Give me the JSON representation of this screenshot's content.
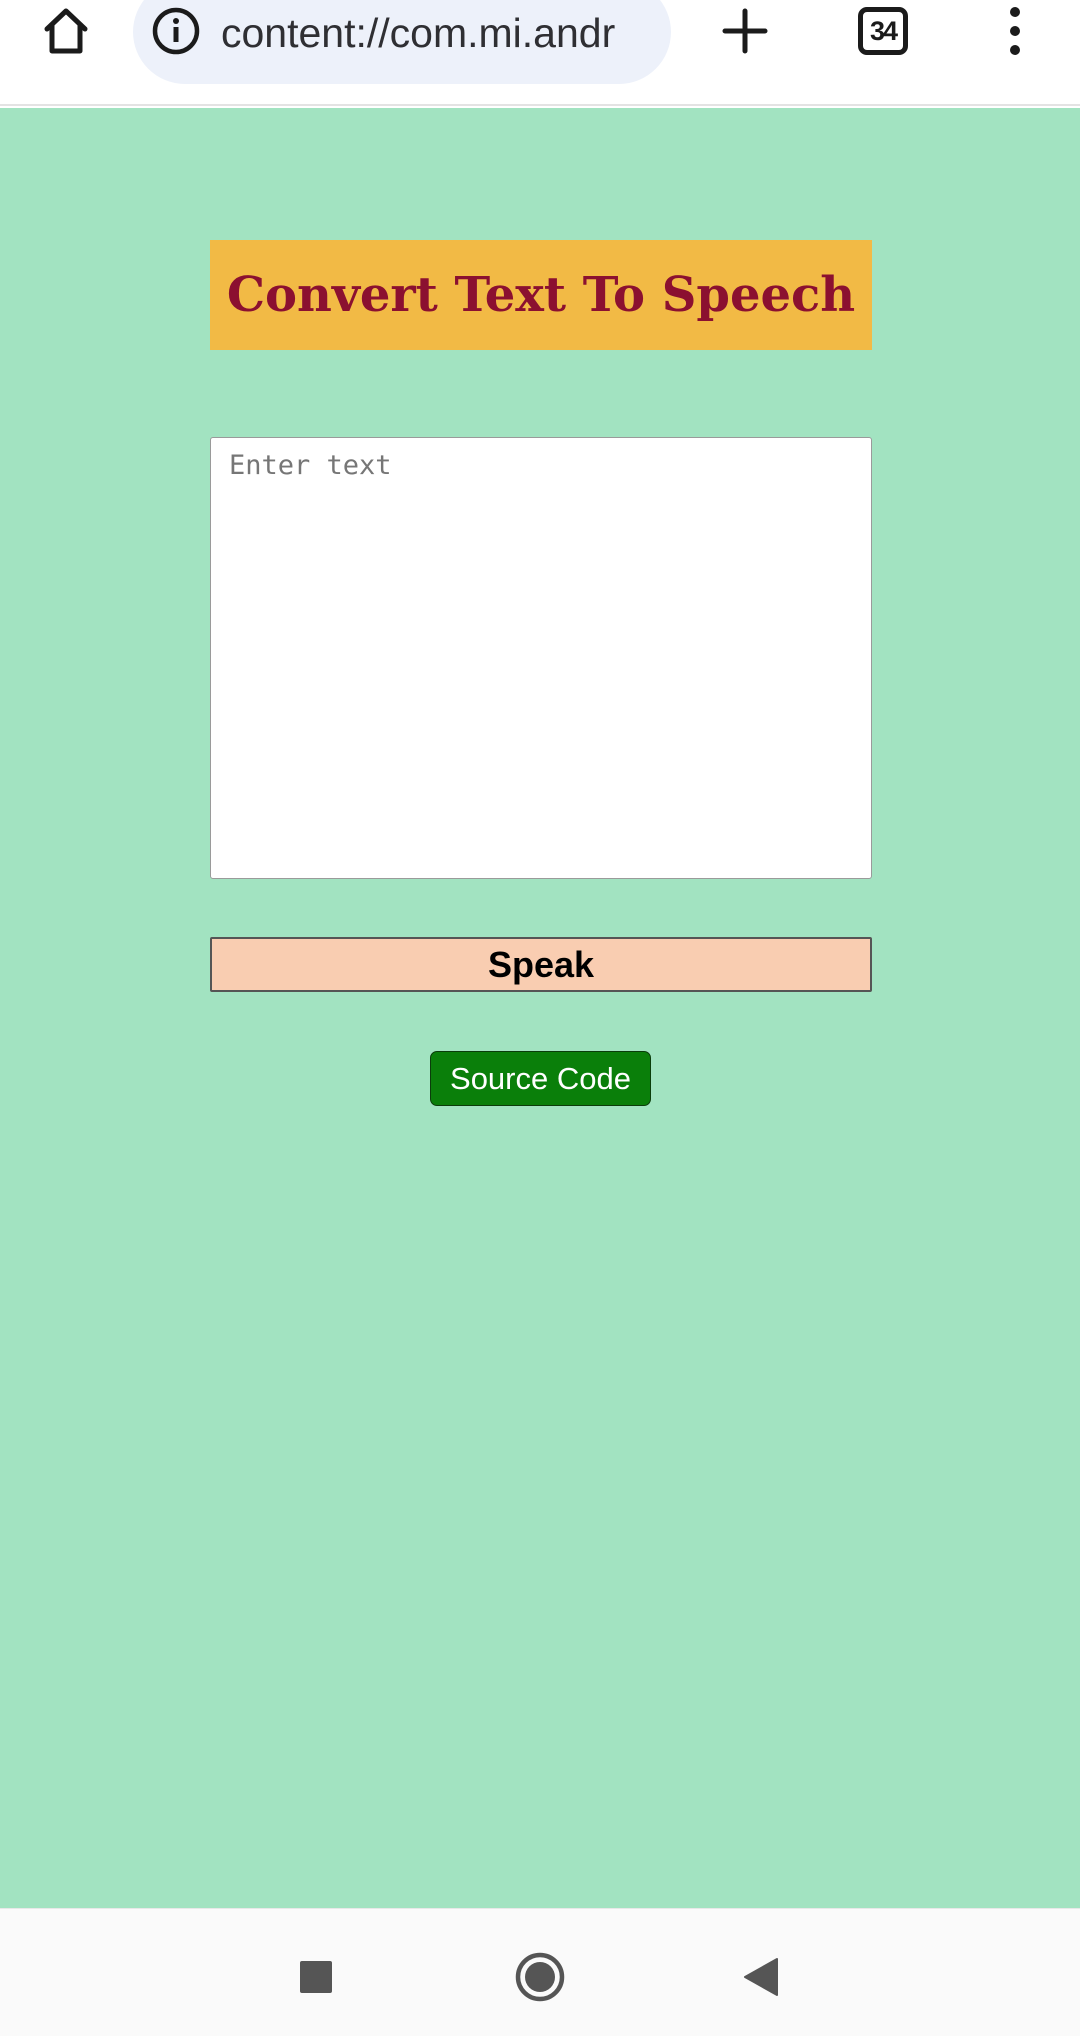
{
  "browser": {
    "url": "content://com.mi.andr",
    "tab_count": "34",
    "icons": {
      "home": "home-icon",
      "info": "info-icon",
      "new_tab": "plus-icon",
      "menu": "more-vert-icon"
    }
  },
  "app": {
    "title": "Convert Text To Speech",
    "input_placeholder": "Enter text",
    "input_value": "",
    "speak_label": "Speak",
    "source_label": "Source Code"
  },
  "colors": {
    "page_bg": "#a2e3c1",
    "title_bg": "#f2ba45",
    "title_text": "#8b1030",
    "speak_bg": "#f9cdb1",
    "source_bg": "#0a7f0a"
  },
  "system_nav": {
    "icons": [
      "square-recents-icon",
      "circle-home-icon",
      "triangle-back-icon"
    ]
  }
}
